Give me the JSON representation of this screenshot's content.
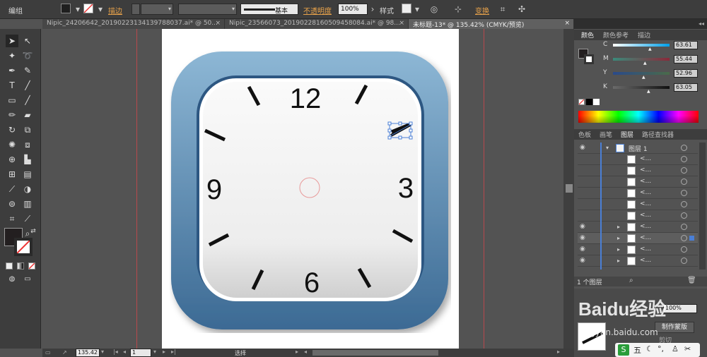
{
  "control_bar": {
    "mode_label": "编组",
    "stroke_label": "描边",
    "stroke_profile": "基本",
    "opacity_label": "不透明度",
    "opacity_value": "100%",
    "style_label": "样式",
    "transform_label": "变换"
  },
  "doc_tabs": [
    {
      "label": "Nipic_24206642_20190223134139788037.ai* @ 50...",
      "close": "×"
    },
    {
      "label": "Nipic_23566073_20190228160509458084.ai* @ 98...",
      "close": "×"
    },
    {
      "label": "未标题-13* @ 135.42% (CMYK/预览)",
      "close": "×"
    }
  ],
  "clock": {
    "num_12": "12",
    "num_3": "3",
    "num_6": "6",
    "num_9": "9"
  },
  "color_panel": {
    "tabs": [
      "颜色",
      "颜色参考",
      "描边"
    ],
    "channels": [
      {
        "label": "C",
        "value": "63.61",
        "pos": 0.64
      },
      {
        "label": "M",
        "value": "55.44",
        "pos": 0.55
      },
      {
        "label": "Y",
        "value": "52.96",
        "pos": 0.53
      },
      {
        "label": "K",
        "value": "63.05",
        "pos": 0.63
      }
    ]
  },
  "layers_panel": {
    "tabs": [
      "色板",
      "画笔",
      "图层",
      "路径查找器"
    ],
    "top_layer": "图层 1",
    "sublayer_name": "<...",
    "footer": "1 个图层"
  },
  "overlay_panel": {
    "opacity_value": "100%",
    "make_mask_button": "制作蒙版",
    "clip_label": "剪切"
  },
  "status_bar": {
    "zoom_value": "135.42",
    "page_value": "1",
    "tool_label": "选择"
  },
  "watermark": {
    "text": "Baidu经验",
    "url": "jingyan.baidu.com"
  },
  "colors": {
    "frame_top": "#8db7d5",
    "frame_bottom": "#3c6a94",
    "guide": "#b8484c"
  }
}
